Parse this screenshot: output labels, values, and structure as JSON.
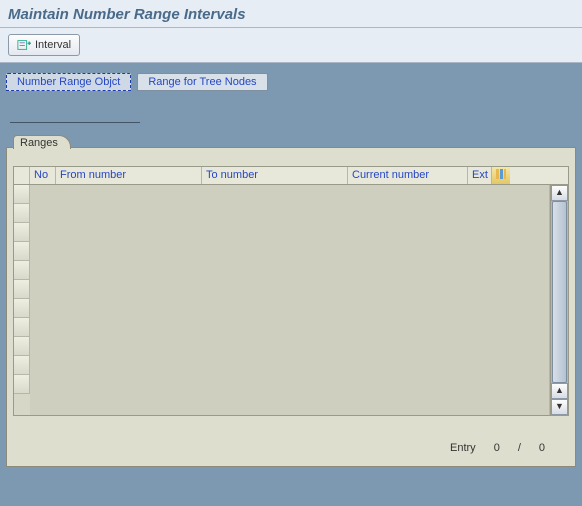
{
  "title": "Maintain Number Range Intervals",
  "toolbar": {
    "interval_label": "Interval"
  },
  "tabs": {
    "nro": "Number Range Objct",
    "tree": "Range for Tree Nodes"
  },
  "ranges": {
    "frame_title": "Ranges",
    "columns": {
      "no": "No",
      "from": "From number",
      "to": "To number",
      "current": "Current number",
      "ext": "Ext"
    },
    "rows": []
  },
  "footer": {
    "entry_label": "Entry",
    "current": "0",
    "sep": "/",
    "total": "0"
  }
}
